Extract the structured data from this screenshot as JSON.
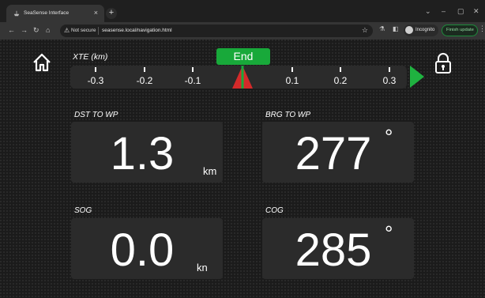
{
  "browser": {
    "tab_title": "SeaSense Interface",
    "tab_close": "×",
    "new_tab": "+",
    "security_label": "Not secure",
    "url": "seasense.local/navigation.html",
    "incognito_label": "Incognito",
    "finish_update_label": "Finish update",
    "icons": [
      "ship-favicon",
      "close-icon",
      "plus-icon",
      "back-icon",
      "forward-icon",
      "reload-icon",
      "home-icon",
      "warning-icon",
      "star-icon",
      "extensions-icon",
      "sidepanel-icon",
      "incognito-icon",
      "menu-icon"
    ]
  },
  "xte": {
    "label": "XTE (km)",
    "ticks": [
      "-0.3",
      "-0.2",
      "-0.1",
      "0.1",
      "0.2",
      "0.3"
    ],
    "end_label": "End",
    "arrow_color": "#1fb240"
  },
  "panels": {
    "dst": {
      "label": "DST TO WP",
      "value": "1.3",
      "unit": "km"
    },
    "brg": {
      "label": "BRG TO WP",
      "value": "277",
      "unit": "°"
    },
    "sog": {
      "label": "SOG",
      "value": "0.0",
      "unit": "kn"
    },
    "cog": {
      "label": "COG",
      "value": "285",
      "unit": "°"
    }
  },
  "colors": {
    "accent_green": "#18a93a",
    "boat_red": "#d42a2a",
    "panel_bg": "#2b2b2b"
  }
}
